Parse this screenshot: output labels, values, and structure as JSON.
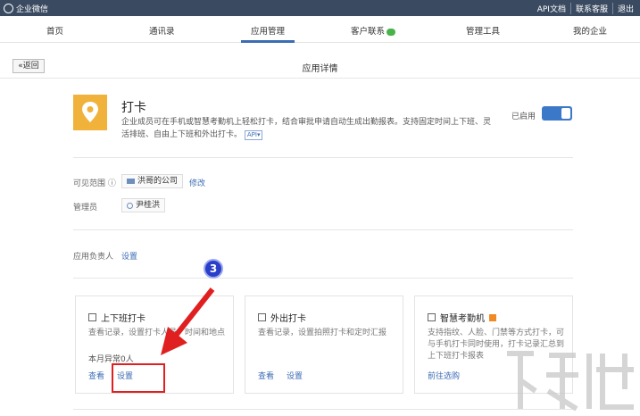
{
  "topbar": {
    "brand": "企业微信",
    "links": [
      "API文档",
      "联系客服",
      "退出"
    ]
  },
  "nav": {
    "tabs": [
      "首页",
      "通讯录",
      "应用管理",
      "客户联系",
      "管理工具",
      "我的企业"
    ],
    "active": "应用管理"
  },
  "subbar": {
    "back_label": "«返回",
    "title": "应用详情"
  },
  "app": {
    "name": "打卡",
    "description": "企业成员可在手机或智慧考勤机上轻松打卡，结合审批申请自动生成出勤报表。支持固定时间上下班、灵活排班、自由上下班和外出打卡。",
    "api_tag": "API",
    "status_label": "已启用",
    "enabled": true,
    "icon": "location-pin-icon",
    "icon_color": "#f0b23a"
  },
  "scope": {
    "label": "可见范围",
    "value": "洪哥的公司",
    "edit": "修改"
  },
  "admin": {
    "label": "管理员",
    "value": "尹桂洪"
  },
  "owner": {
    "label": "应用负责人",
    "action": "设置"
  },
  "cards": [
    {
      "title": "上下班打卡",
      "desc": "查看记录，设置打卡人员、时间和地点",
      "stat": "本月异常0人",
      "links": [
        "查看",
        "设置"
      ]
    },
    {
      "title": "外出打卡",
      "desc": "查看记录，设置拍照打卡和定时汇报",
      "links": [
        "查看",
        "设置"
      ]
    },
    {
      "title": "智慧考勤机",
      "desc": "支持指纹、人脸、门禁等方式打卡，可与手机打卡同时使用，打卡记录汇总到上下班打卡报表",
      "links": [
        "前往选购"
      ]
    }
  ],
  "annotation": {
    "step": "3"
  },
  "colors": {
    "accent": "#3c6cb4",
    "topbar": "#3a4a60",
    "highlight": "#e02020"
  }
}
